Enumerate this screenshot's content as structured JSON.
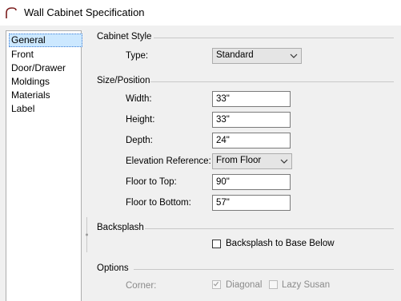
{
  "window": {
    "title": "Wall Cabinet Specification"
  },
  "sidebar": {
    "items": [
      {
        "label": "General",
        "selected": true
      },
      {
        "label": "Front"
      },
      {
        "label": "Door/Drawer"
      },
      {
        "label": "Moldings"
      },
      {
        "label": "Materials"
      },
      {
        "label": "Label"
      }
    ]
  },
  "cabinet_style": {
    "heading": "Cabinet Style",
    "type_label": "Type:",
    "type_value": "Standard"
  },
  "size_position": {
    "heading": "Size/Position",
    "width_label": "Width:",
    "width_value": "33\"",
    "height_label": "Height:",
    "height_value": "33\"",
    "depth_label": "Depth:",
    "depth_value": "24\"",
    "elevation_label": "Elevation Reference:",
    "elevation_value": "From Floor",
    "floor_top_label": "Floor to Top:",
    "floor_top_value": "90\"",
    "floor_bottom_label": "Floor to Bottom:",
    "floor_bottom_value": "57\""
  },
  "backsplash": {
    "heading": "Backsplash",
    "checkbox_label": "Backsplash to Base Below",
    "checked": false
  },
  "options": {
    "heading": "Options",
    "corner_label": "Corner:",
    "diagonal_label": "Diagonal",
    "diagonal_checked": true,
    "lazy_susan_label": "Lazy Susan",
    "lazy_susan_checked": false
  }
}
